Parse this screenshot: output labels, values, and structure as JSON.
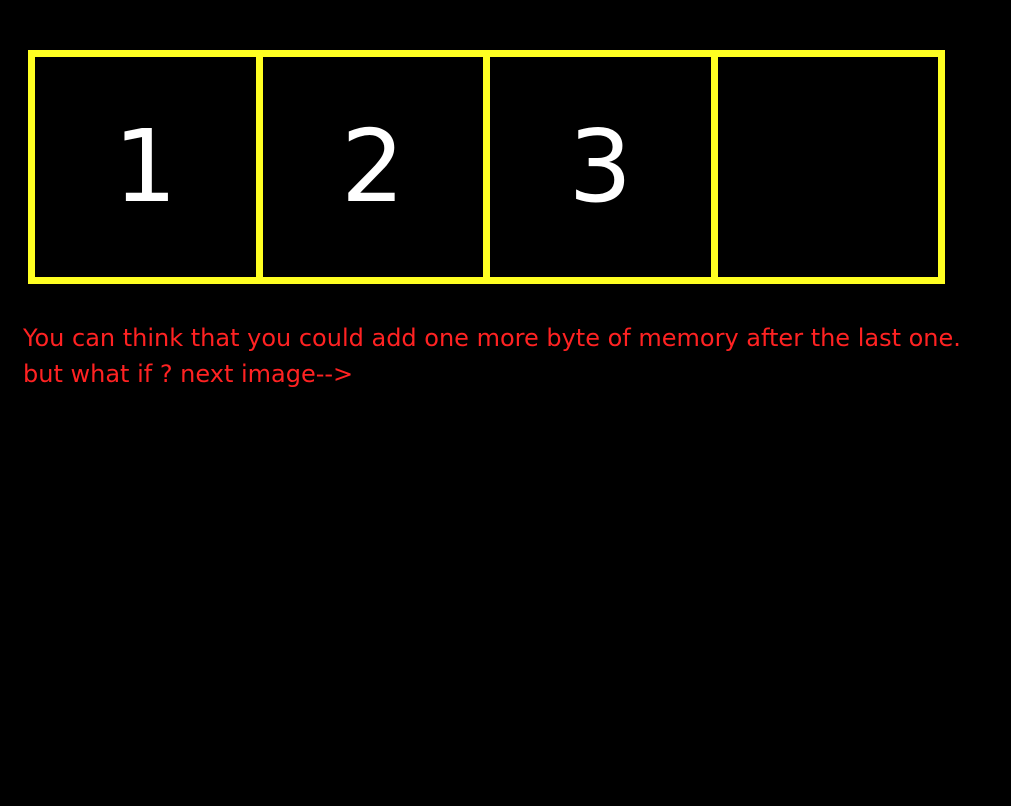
{
  "diagram": {
    "cells": [
      "1",
      "2",
      "3",
      ""
    ],
    "border_color": "#ffff22",
    "text_color": "#ffffff"
  },
  "caption": {
    "line1": "You can think that you could add one more byte of memory after the last one.",
    "line2": "but what if ? next image-->",
    "color": "#ff2222"
  }
}
